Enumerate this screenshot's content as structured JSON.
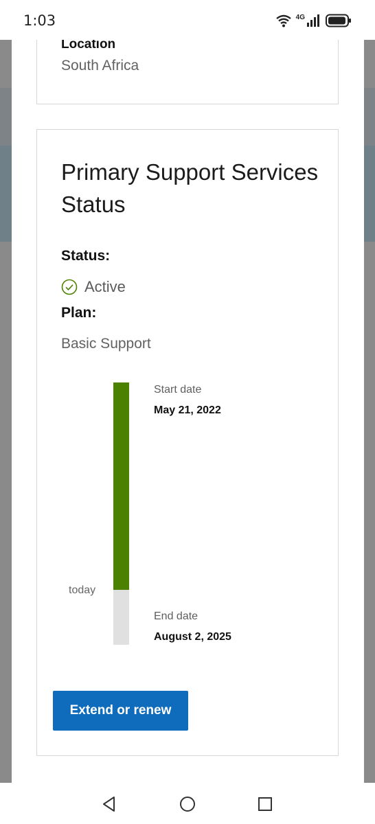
{
  "status_bar": {
    "time": "1:03",
    "network_label": "4G",
    "icons": [
      "wifi-icon",
      "signal-icon",
      "battery-icon"
    ]
  },
  "location_card": {
    "label": "Location",
    "value": "South Africa"
  },
  "status_card": {
    "title": "Primary Support Services Status",
    "status_label": "Status:",
    "status_value": "Active",
    "plan_label": "Plan:",
    "plan_value": "Basic Support",
    "timeline": {
      "start_label": "Start date",
      "start_value": "May 21, 2022",
      "today_label": "today",
      "end_label": "End date",
      "end_value": "August 2, 2025",
      "elapsed_fraction": 0.79
    },
    "button_label": "Extend or renew"
  },
  "colors": {
    "accent_blue": "#0f6cbd",
    "active_green": "#4c8100",
    "track_gray": "#e0e0e0"
  },
  "nav_bar": {
    "icons": [
      "back-icon",
      "home-icon",
      "recents-icon"
    ]
  }
}
